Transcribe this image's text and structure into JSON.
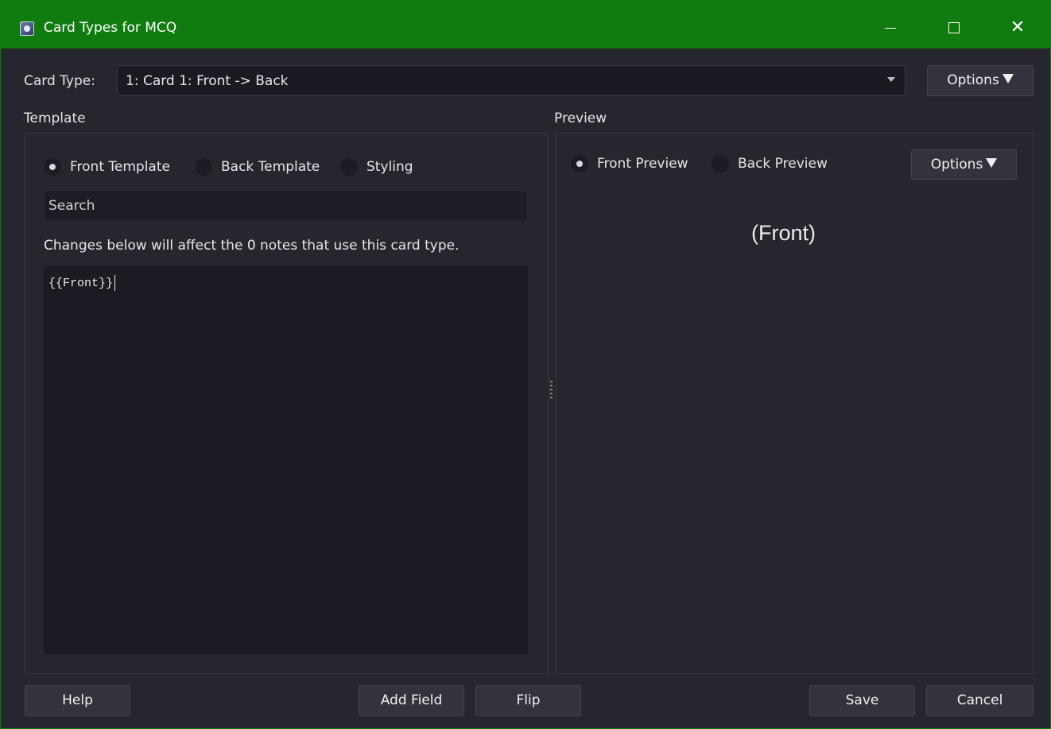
{
  "window": {
    "title": "Card Types for MCQ",
    "controls": {
      "minimize": "minimize-icon",
      "maximize": "maximize-icon",
      "close": "close-icon"
    },
    "accent_color": "#107c10"
  },
  "card_type": {
    "label": "Card Type:",
    "selected": "1: Card 1: Front -> Back",
    "options_label": "Options"
  },
  "template": {
    "section_label": "Template",
    "radios": [
      {
        "label": "Front Template",
        "checked": true
      },
      {
        "label": "Back Template",
        "checked": false
      },
      {
        "label": "Styling",
        "checked": false
      }
    ],
    "search_placeholder": "Search",
    "notice": "Changes below will affect the 0 notes that use this card type.",
    "editor_content": "{{Front}}"
  },
  "preview": {
    "section_label": "Preview",
    "radios": [
      {
        "label": "Front Preview",
        "checked": true
      },
      {
        "label": "Back Preview",
        "checked": false
      }
    ],
    "options_label": "Options",
    "rendered_text": "(Front)"
  },
  "footer": {
    "help": "Help",
    "add_field": "Add Field",
    "flip": "Flip",
    "save": "Save",
    "cancel": "Cancel"
  }
}
